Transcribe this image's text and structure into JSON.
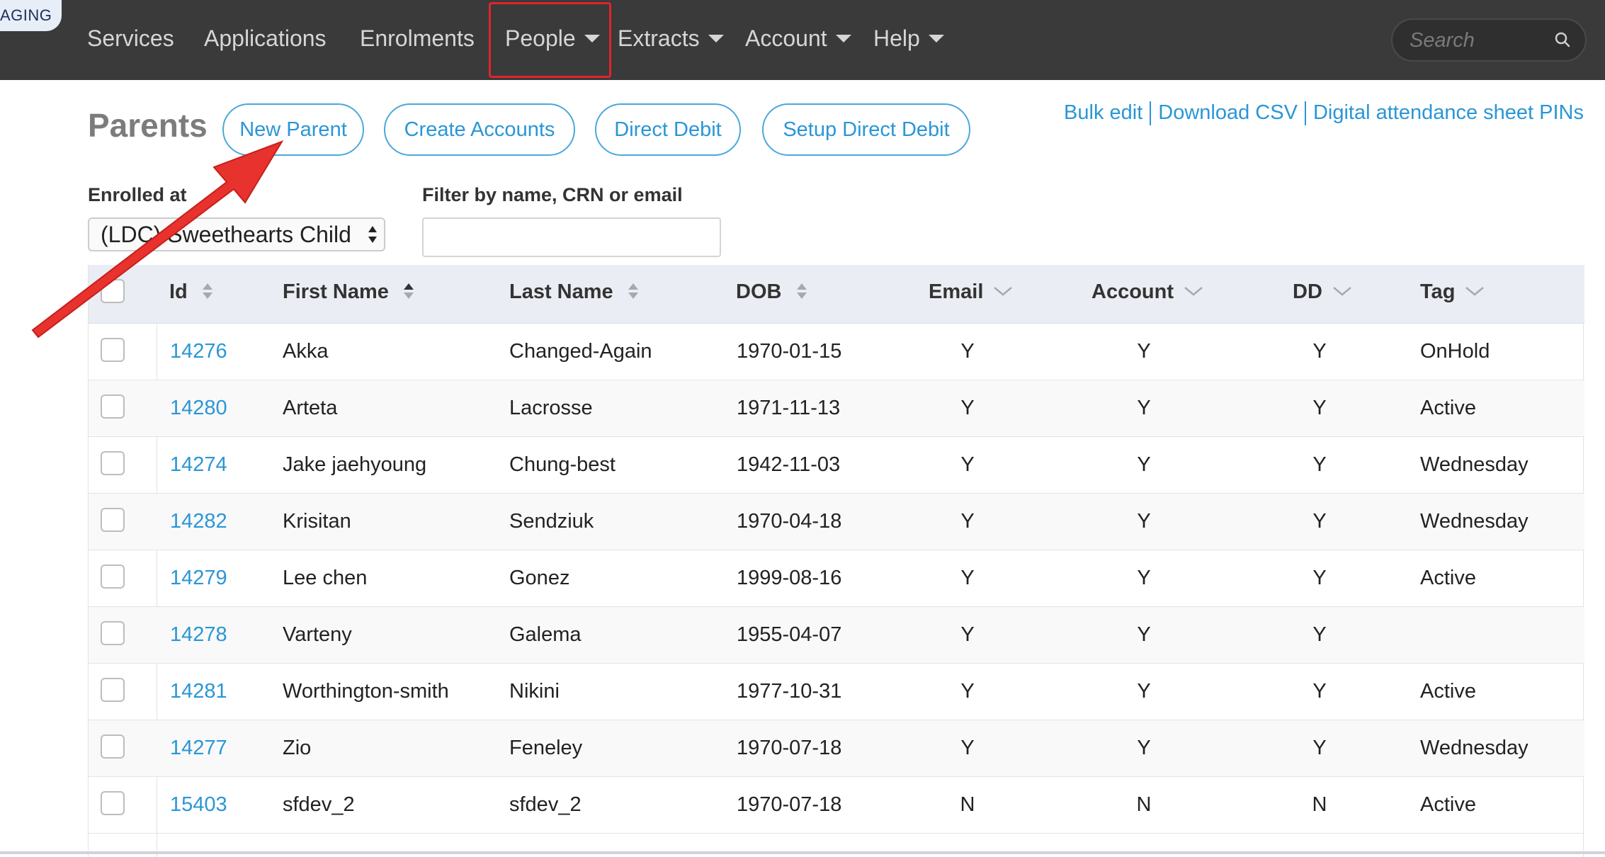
{
  "env_badge": "AGING",
  "nav": {
    "items": [
      {
        "label": "Services"
      },
      {
        "label": "Applications"
      },
      {
        "label": "Enrolments"
      },
      {
        "label": "People"
      },
      {
        "label": "Extracts"
      },
      {
        "label": "Account"
      },
      {
        "label": "Help"
      }
    ],
    "search_placeholder": "Search"
  },
  "header": {
    "title": "Parents",
    "buttons": {
      "new_parent": "New Parent",
      "create_accounts": "Create Accounts",
      "direct_debit": "Direct Debit",
      "setup_direct_debit": "Setup Direct Debit"
    },
    "links": {
      "bulk_edit": "Bulk edit",
      "download_csv": "Download CSV",
      "pins": "Digital attendance sheet PINs"
    }
  },
  "filters": {
    "enrolled_label": "Enrolled at",
    "enrolled_value": "(LDC) Sweethearts Child",
    "search_label": "Filter by name, CRN or email",
    "search_value": ""
  },
  "table": {
    "headers": {
      "id": "Id",
      "first": "First Name",
      "last": "Last Name",
      "dob": "DOB",
      "email": "Email",
      "account": "Account",
      "dd": "DD",
      "tag": "Tag"
    },
    "rows": [
      {
        "id": "14276",
        "first": "Akka",
        "last": "Changed-Again",
        "dob": "1970-01-15",
        "email": "Y",
        "account": "Y",
        "dd": "Y",
        "tag": "OnHold"
      },
      {
        "id": "14280",
        "first": "Arteta",
        "last": "Lacrosse",
        "dob": "1971-11-13",
        "email": "Y",
        "account": "Y",
        "dd": "Y",
        "tag": "Active"
      },
      {
        "id": "14274",
        "first": "Jake jaehyoung",
        "last": "Chung-best",
        "dob": "1942-11-03",
        "email": "Y",
        "account": "Y",
        "dd": "Y",
        "tag": "Wednesday"
      },
      {
        "id": "14282",
        "first": "Krisitan",
        "last": "Sendziuk",
        "dob": "1970-04-18",
        "email": "Y",
        "account": "Y",
        "dd": "Y",
        "tag": "Wednesday"
      },
      {
        "id": "14279",
        "first": "Lee chen",
        "last": "Gonez",
        "dob": "1999-08-16",
        "email": "Y",
        "account": "Y",
        "dd": "Y",
        "tag": "Active"
      },
      {
        "id": "14278",
        "first": "Varteny",
        "last": "Galema",
        "dob": "1955-04-07",
        "email": "Y",
        "account": "Y",
        "dd": "Y",
        "tag": ""
      },
      {
        "id": "14281",
        "first": "Worthington-smith",
        "last": "Nikini",
        "dob": "1977-10-31",
        "email": "Y",
        "account": "Y",
        "dd": "Y",
        "tag": "Active"
      },
      {
        "id": "14277",
        "first": "Zio",
        "last": "Feneley",
        "dob": "1970-07-18",
        "email": "Y",
        "account": "Y",
        "dd": "Y",
        "tag": "Wednesday"
      },
      {
        "id": "15403",
        "first": "sfdev_2",
        "last": "sfdev_2",
        "dob": "1970-07-18",
        "email": "N",
        "account": "N",
        "dd": "N",
        "tag": "Active"
      }
    ]
  },
  "colors": {
    "nav_bg": "#3a3a3a",
    "link": "#2a96d6",
    "highlight": "#e0242b",
    "arrow": "#e8322e"
  }
}
